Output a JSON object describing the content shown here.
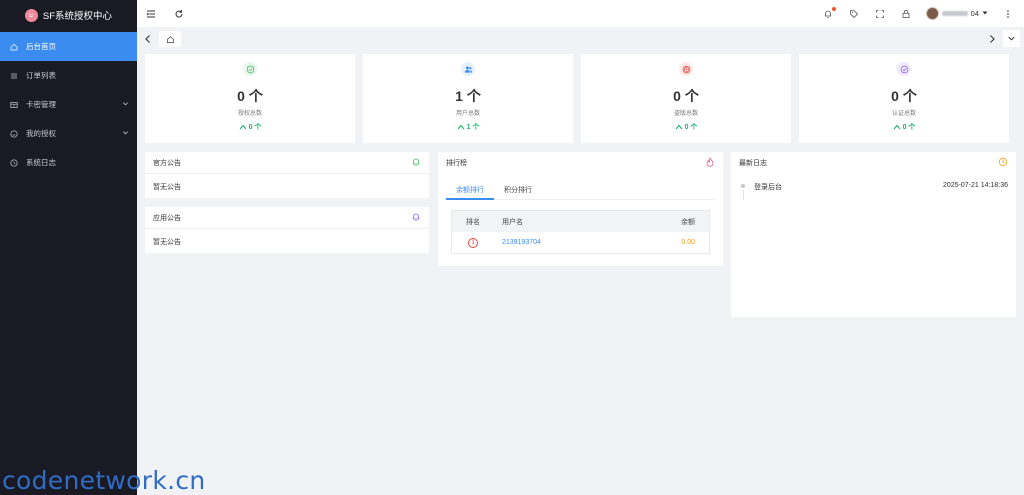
{
  "app": {
    "title": "SF系统授权中心"
  },
  "sidebar": {
    "items": [
      {
        "label": "后台首页",
        "icon": "home-icon",
        "active": true
      },
      {
        "label": "订单列表",
        "icon": "list-icon"
      },
      {
        "label": "卡密管理",
        "icon": "card-icon",
        "expandable": true
      },
      {
        "label": "我的授权",
        "icon": "smile-icon",
        "expandable": true
      },
      {
        "label": "系统日志",
        "icon": "clock-icon"
      }
    ]
  },
  "header": {
    "user_suffix": "04",
    "icons": [
      "menu-toggle-icon",
      "refresh-icon",
      "bell-icon",
      "tag-icon",
      "fullscreen-icon",
      "lock-icon",
      "more-icon"
    ]
  },
  "stats": [
    {
      "value": "0 个",
      "label": "授权总数",
      "trend": "0 个",
      "icon": "shield-icon",
      "color": "#3cb95a",
      "bg": "#e8f7ec"
    },
    {
      "value": "1 个",
      "label": "用户总数",
      "trend": "1 个",
      "icon": "users-icon",
      "color": "#3b8cf0",
      "bg": "#e6f0fd"
    },
    {
      "value": "0 个",
      "label": "盗版总数",
      "trend": "0 个",
      "icon": "target-icon",
      "color": "#e6453d",
      "bg": "#fde9e8"
    },
    {
      "value": "0 个",
      "label": "认证总数",
      "trend": "0 个",
      "icon": "check-icon",
      "color": "#8b5cf0",
      "bg": "#f0e9fd"
    }
  ],
  "official_notice": {
    "title": "官方公告",
    "content": "暂无公告",
    "icon_color": "#3cb95a"
  },
  "app_notice": {
    "title": "应用公告",
    "content": "暂无公告",
    "icon_color": "#8b5cf0"
  },
  "ranking": {
    "title": "排行榜",
    "tabs": [
      "余额排行",
      "积分排行"
    ],
    "columns": [
      "排名",
      "用户名",
      "余额"
    ],
    "rows": [
      {
        "rank": "1",
        "username": "2139193704",
        "balance": "0.00"
      }
    ]
  },
  "logs": {
    "title": "最新日志",
    "items": [
      {
        "action": "登录后台",
        "time": "2025-07-21 14:18:36"
      }
    ]
  },
  "watermark": "codenetwork.cn",
  "colors": {
    "accent": "#3b8cf0",
    "sidebar_bg": "#191a23",
    "success": "#19b26c",
    "balance": "#f0a020"
  }
}
